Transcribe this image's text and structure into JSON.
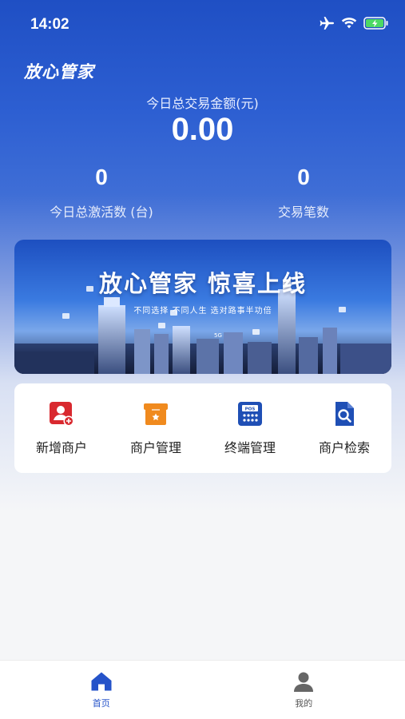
{
  "status_bar": {
    "time": "14:02"
  },
  "header": {
    "app_name": "放心管家",
    "total_amount_label": "今日总交易金额(元)",
    "total_amount_value": "0.00",
    "activations_value": "0",
    "activations_label": "今日总激活数 (台)",
    "transactions_value": "0",
    "transactions_label": "交易笔数"
  },
  "banner": {
    "title": "放心管家 惊喜上线",
    "subtitle": "不同选择 不同人生 选对路事半功倍"
  },
  "menu": {
    "items": [
      {
        "label": "新增商户",
        "icon": "add-merchant-icon",
        "color": "#d9292f"
      },
      {
        "label": "商户管理",
        "icon": "shop-manage-icon",
        "color": "#f08a1e"
      },
      {
        "label": "终端管理",
        "icon": "pos-terminal-icon",
        "color": "#1f4fb5"
      },
      {
        "label": "商户检索",
        "icon": "search-doc-icon",
        "color": "#1f4fb5"
      }
    ]
  },
  "tabbar": {
    "home_label": "首页",
    "mine_label": "我的",
    "active_color": "#2553c9",
    "inactive_color": "#555555"
  }
}
